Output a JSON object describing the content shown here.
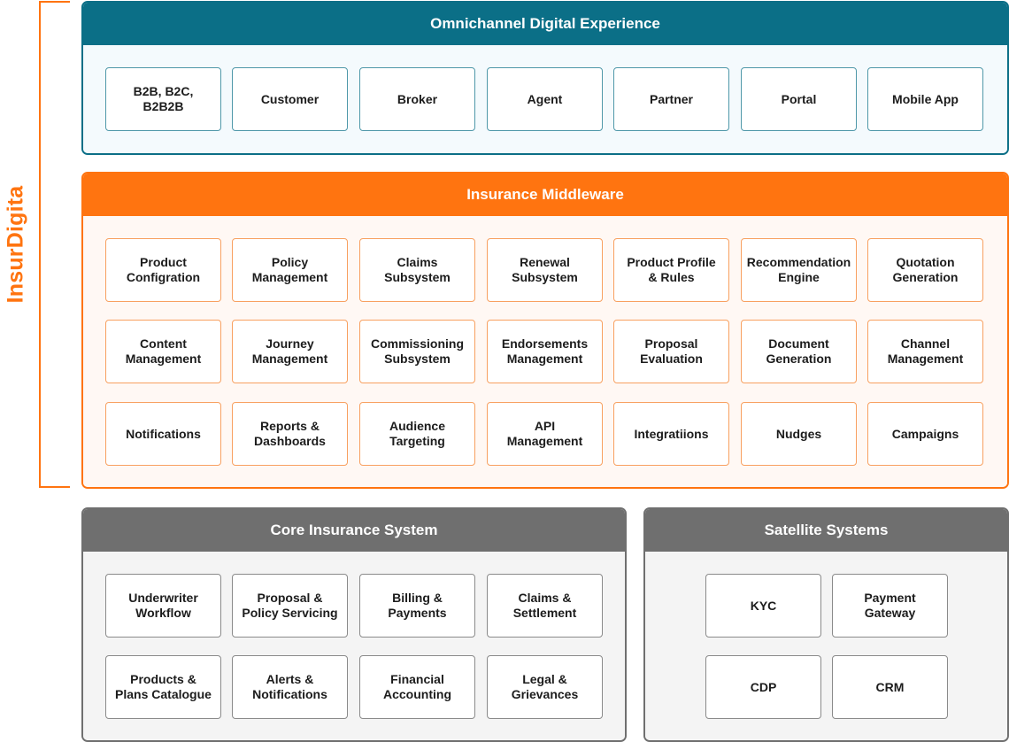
{
  "brand": {
    "label": "InsurDigita",
    "color": "#ff7410"
  },
  "omnichannel": {
    "title": "Omnichannel Digital Experience",
    "color": "#0b6f87",
    "items": [
      "B2B, B2C,\nB2B2B",
      "Customer",
      "Broker",
      "Agent",
      "Partner",
      "Portal",
      "Mobile App"
    ]
  },
  "middleware": {
    "title": "Insurance Middleware",
    "color": "#ff7410",
    "rows": [
      [
        "Product\nConfigration",
        "Policy\nManagement",
        "Claims\nSubsystem",
        "Renewal\nSubsystem",
        "Product Profile\n& Rules",
        "Recommendation\nEngine",
        "Quotation\nGeneration"
      ],
      [
        "Content\nManagement",
        "Journey\nManagement",
        "Commissioning\nSubsystem",
        "Endorsements\nManagement",
        "Proposal\nEvaluation",
        "Document\nGeneration",
        "Channel\nManagement"
      ],
      [
        "Notifications",
        "Reports &\nDashboards",
        "Audience\nTargeting",
        "API\nManagement",
        "Integratiions",
        "Nudges",
        "Campaigns"
      ]
    ]
  },
  "core": {
    "title": "Core Insurance System",
    "color": "#6f6f6f",
    "rows": [
      [
        "Underwriter\nWorkflow",
        "Proposal &\nPolicy Servicing",
        "Billing &\nPayments",
        "Claims &\nSettlement"
      ],
      [
        "Products &\nPlans Catalogue",
        "Alerts &\nNotifications",
        "Financial\nAccounting",
        "Legal &\nGrievances"
      ]
    ]
  },
  "satellite": {
    "title": "Satellite Systems",
    "color": "#6f6f6f",
    "rows": [
      [
        "KYC",
        "Payment\nGateway"
      ],
      [
        "CDP",
        "CRM"
      ]
    ]
  }
}
